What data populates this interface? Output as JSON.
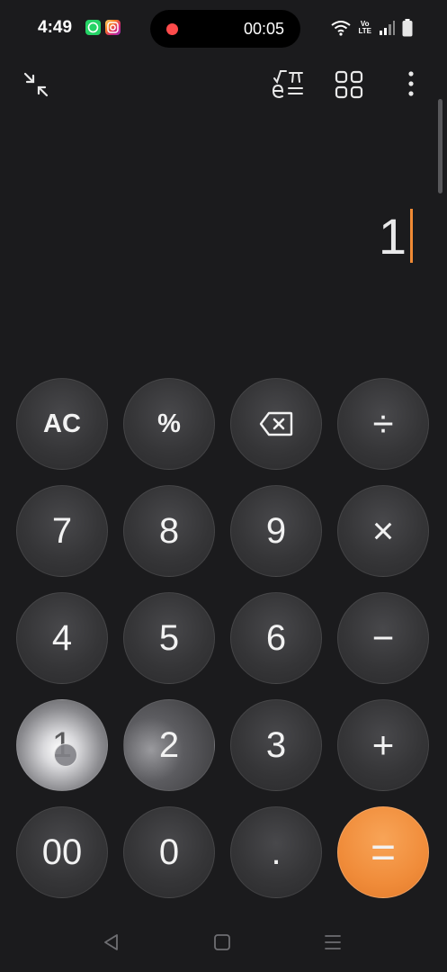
{
  "status": {
    "time": "4:49",
    "apps": [
      "whatsapp-icon",
      "instagram-icon"
    ],
    "recording_time": "00:05",
    "volte_top": "Vo",
    "volte_bottom": "LTE"
  },
  "toolbar": {
    "icons": [
      "collapse-icon",
      "scientific-icon",
      "converter-grid-icon",
      "more-options-icon"
    ]
  },
  "display": {
    "value": "1",
    "cursor_color": "#f08a34"
  },
  "keys": {
    "ac": "AC",
    "percent": "%",
    "backspace": "backspace-icon",
    "divide": "÷",
    "seven": "7",
    "eight": "8",
    "nine": "9",
    "multiply": "×",
    "four": "4",
    "five": "5",
    "six": "6",
    "minus": "−",
    "one": "1",
    "two": "2",
    "three": "3",
    "plus": "+",
    "double_zero": "00",
    "zero": "0",
    "decimal": ".",
    "equals": "="
  },
  "colors": {
    "background": "#1b1b1d",
    "key": "#353537",
    "equals": "#f08c3a"
  },
  "nav": [
    "back-icon",
    "home-icon",
    "recents-icon"
  ]
}
